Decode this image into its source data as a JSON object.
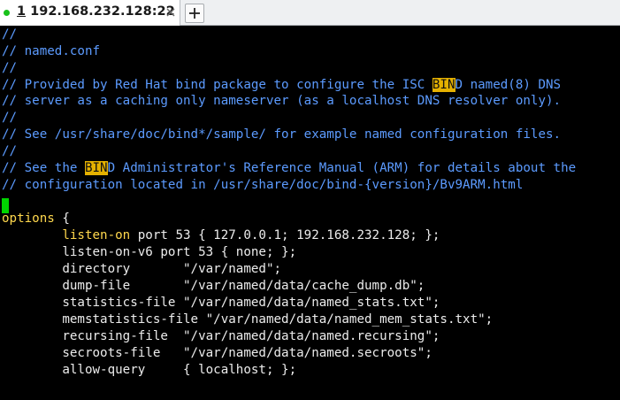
{
  "tab": {
    "number": "1",
    "title": " 192.168.232.128:22",
    "status_color": "#19c11b",
    "close_icon": "close-icon"
  },
  "add_tab": {
    "icon": "plus-icon"
  },
  "colors": {
    "background": "#000000",
    "comment": "#5c9bff",
    "highlight": "#e5b100",
    "keyword": "#ffd84d",
    "text": "#ececec",
    "cursor": "#00d400"
  },
  "terminal": {
    "lines": [
      {
        "segments": [
          {
            "text": "//",
            "style": "c"
          }
        ]
      },
      {
        "segments": [
          {
            "text": "// named.conf",
            "style": "c"
          }
        ]
      },
      {
        "segments": [
          {
            "text": "//",
            "style": "c"
          }
        ]
      },
      {
        "segments": [
          {
            "text": "// Provided by Red Hat bind package to configure the ISC ",
            "style": "c"
          },
          {
            "text": "BIN",
            "style": "hl"
          },
          {
            "text": "D named(8) DNS",
            "style": "c"
          }
        ]
      },
      {
        "segments": [
          {
            "text": "// server as a caching only nameserver (as a localhost DNS resolver only).",
            "style": "c"
          }
        ]
      },
      {
        "segments": [
          {
            "text": "//",
            "style": "c"
          }
        ]
      },
      {
        "segments": [
          {
            "text": "// See /usr/share/doc/bind*/sample/ for example named configuration files.",
            "style": "c"
          }
        ]
      },
      {
        "segments": [
          {
            "text": "//",
            "style": "c"
          }
        ]
      },
      {
        "segments": [
          {
            "text": "// See the ",
            "style": "c"
          },
          {
            "text": "BIN",
            "style": "hl"
          },
          {
            "text": "D Administrator's Reference Manual (ARM) for details about the",
            "style": "c"
          }
        ]
      },
      {
        "segments": [
          {
            "text": "// configuration located in /usr/share/doc/bind-{version}/Bv9ARM.html",
            "style": "c"
          }
        ]
      },
      {
        "segments": []
      },
      {
        "segments": [
          {
            "text": "options",
            "style": "y"
          },
          {
            "text": " {",
            "style": "w"
          }
        ]
      },
      {
        "segments": [
          {
            "text": "        ",
            "style": "w"
          },
          {
            "text": "listen-on",
            "style": "y"
          },
          {
            "text": " port 53 { 127.0.0.1; 192.168.232.128; };",
            "style": "w"
          }
        ]
      },
      {
        "segments": [
          {
            "text": "        listen-on-v6 port 53 { none; };",
            "style": "w"
          }
        ]
      },
      {
        "segments": [
          {
            "text": "        directory       \"/var/named\";",
            "style": "w"
          }
        ]
      },
      {
        "segments": [
          {
            "text": "        dump-file       \"/var/named/data/cache_dump.db\";",
            "style": "w"
          }
        ]
      },
      {
        "segments": [
          {
            "text": "        statistics-file \"/var/named/data/named_stats.txt\";",
            "style": "w"
          }
        ]
      },
      {
        "segments": [
          {
            "text": "        memstatistics-file \"/var/named/data/named_mem_stats.txt\";",
            "style": "w"
          }
        ]
      },
      {
        "segments": [
          {
            "text": "        recursing-file  \"/var/named/data/named.recursing\";",
            "style": "w"
          }
        ]
      },
      {
        "segments": [
          {
            "text": "        secroots-file   \"/var/named/data/named.secroots\";",
            "style": "w"
          }
        ]
      },
      {
        "segments": [
          {
            "text": "        allow-query     { localhost; };",
            "style": "w"
          }
        ]
      }
    ]
  }
}
